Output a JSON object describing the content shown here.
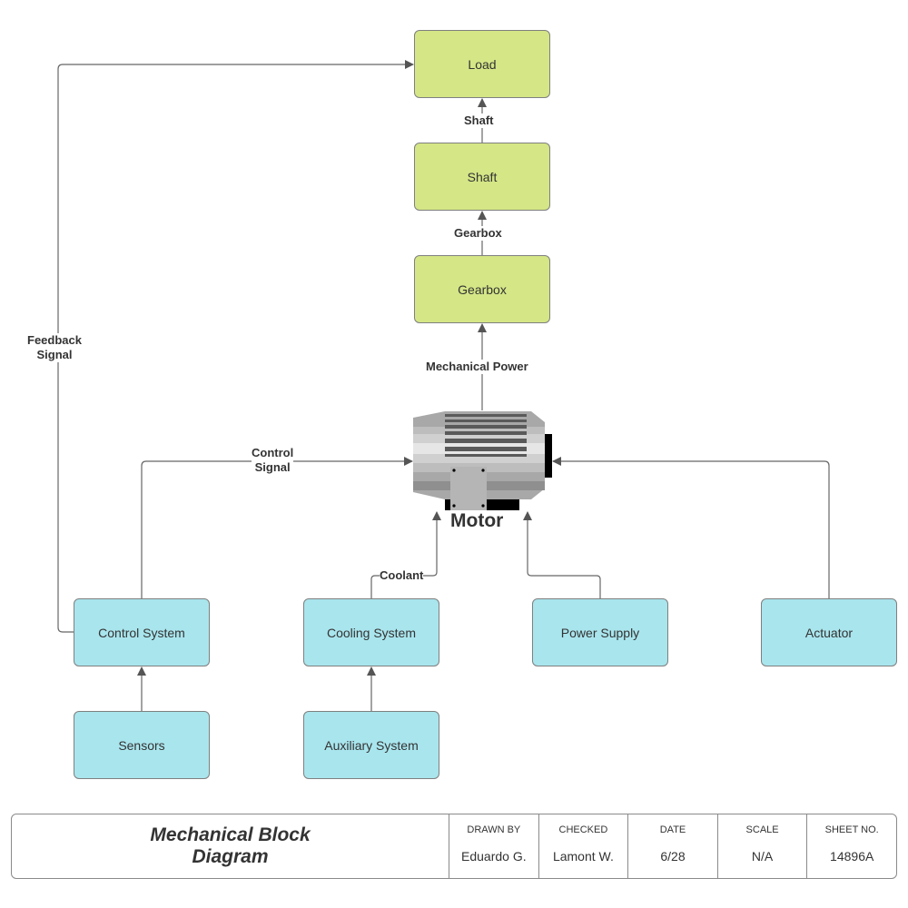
{
  "diagram": {
    "title": "Mechanical Block Diagram",
    "title_line1": "Mechanical Block",
    "title_line2": "Diagram",
    "colors": {
      "output_block": "#d4e686",
      "input_block": "#a9e5ed",
      "line": "#666666"
    },
    "blocks": {
      "load": "Load",
      "shaft": "Shaft",
      "gearbox": "Gearbox",
      "control_system": "Control System",
      "cooling_system": "Cooling System",
      "power_supply": "Power Supply",
      "actuator": "Actuator",
      "sensors": "Sensors",
      "auxiliary_system": "Auxiliary System"
    },
    "motor": {
      "label": "Motor",
      "icon": "electric-motor-icon"
    },
    "edges": {
      "shaft_to_load": "Shaft",
      "gearbox_to_shaft": "Gearbox",
      "motor_to_gearbox": "Mechanical Power",
      "control_to_motor_1": "Control",
      "control_to_motor_2": "Signal",
      "feedback_1": "Feedback",
      "feedback_2": "Signal",
      "coolant": "Coolant"
    }
  },
  "title_block": {
    "columns": [
      {
        "header": "DRAWN BY",
        "value": "Eduardo G."
      },
      {
        "header": "CHECKED",
        "value": "Lamont W."
      },
      {
        "header": "DATE",
        "value": "6/28"
      },
      {
        "header": "SCALE",
        "value": "N/A"
      },
      {
        "header": "SHEET NO.",
        "value": "14896A"
      }
    ]
  }
}
